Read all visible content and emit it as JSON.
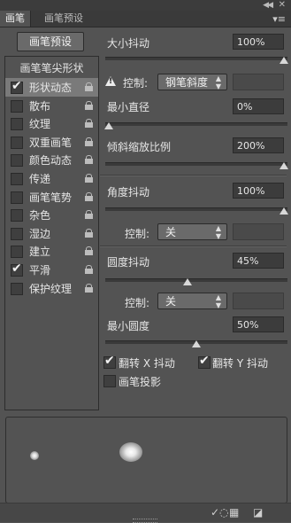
{
  "tabs": {
    "brush": "画笔",
    "brush_presets": "画笔预设"
  },
  "preset_button": "画笔预设",
  "list": {
    "header": "画笔笔尖形状",
    "items": [
      {
        "label": "形状动态",
        "checked": true,
        "selected": true
      },
      {
        "label": "散布",
        "checked": false,
        "selected": false
      },
      {
        "label": "纹理",
        "checked": false,
        "selected": false
      },
      {
        "label": "双重画笔",
        "checked": false,
        "selected": false
      },
      {
        "label": "颜色动态",
        "checked": false,
        "selected": false
      },
      {
        "label": "传递",
        "checked": false,
        "selected": false
      },
      {
        "label": "画笔笔势",
        "checked": false,
        "selected": false
      },
      {
        "label": "杂色",
        "checked": false,
        "selected": false
      },
      {
        "label": "湿边",
        "checked": false,
        "selected": false
      },
      {
        "label": "建立",
        "checked": false,
        "selected": false
      },
      {
        "label": "平滑",
        "checked": true,
        "selected": false
      },
      {
        "label": "保护纹理",
        "checked": false,
        "selected": false
      }
    ]
  },
  "settings": {
    "size_jitter": {
      "label": "大小抖动",
      "value": "100%",
      "level": 1.0
    },
    "size_control": {
      "label": "控制:",
      "selected": "钢笔斜度"
    },
    "min_diameter": {
      "label": "最小直径",
      "value": "0%",
      "level": 0.0
    },
    "tilt_scale": {
      "label": "倾斜缩放比例",
      "value": "200%",
      "level": 1.0
    },
    "angle_jitter": {
      "label": "角度抖动",
      "value": "100%",
      "level": 1.0
    },
    "angle_control": {
      "label": "控制:",
      "selected": "关"
    },
    "roundness_jitter": {
      "label": "圆度抖动",
      "value": "45%",
      "level": 0.45
    },
    "roundness_control": {
      "label": "控制:",
      "selected": "关"
    },
    "min_roundness": {
      "label": "最小圆度",
      "value": "50%",
      "level": 0.5
    },
    "flip_x": {
      "label": "翻转 X 抖动",
      "checked": true
    },
    "flip_y": {
      "label": "翻转 Y 抖动",
      "checked": true
    },
    "brush_projection": {
      "label": "画笔投影",
      "checked": false
    }
  },
  "icons": {
    "collapse": "double-chevron-right-icon",
    "panel_menu": "panel-menu-icon",
    "lock": "lock-icon",
    "warning": "warning-icon"
  }
}
